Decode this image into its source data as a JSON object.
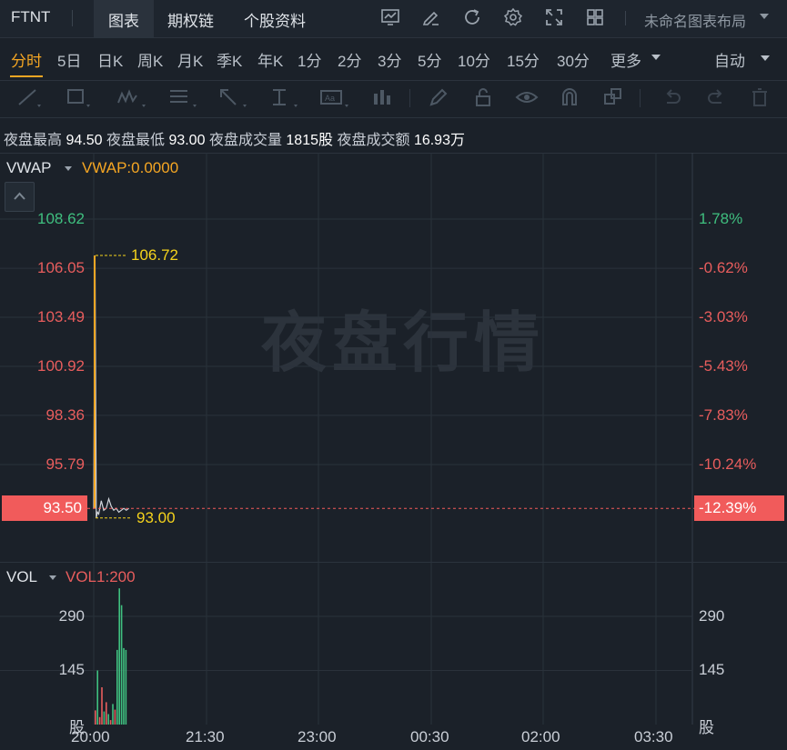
{
  "topbar": {
    "symbol": "FTNT",
    "tabs": [
      "图表",
      "期权链",
      "个股资料"
    ],
    "layout_name": "未命名图表布局"
  },
  "periods": {
    "items": [
      "分时",
      "5日",
      "日K",
      "周K",
      "月K",
      "季K",
      "年K",
      "1分",
      "2分",
      "3分",
      "5分",
      "10分",
      "15分",
      "30分",
      "更多"
    ],
    "active": "分时",
    "auto": "自动"
  },
  "info": {
    "high_label": "夜盘最高",
    "high": "94.50",
    "low_label": "夜盘最低",
    "low": "93.00",
    "vol_label": "夜盘成交量",
    "vol": "1815股",
    "amt_label": "夜盘成交额",
    "amt": "16.93万"
  },
  "main_panel": {
    "indicator": "VWAP",
    "indicator_value": "VWAP:0.0000",
    "watermark": "夜盘行情",
    "current_price": "93.50",
    "current_pct": "-12.39%",
    "max_label": "106.72",
    "min_label": "93.00"
  },
  "vol_panel": {
    "indicator": "VOL",
    "indicator_value": "VOL1:200",
    "unit": "股"
  },
  "colors": {
    "up": "#3fbf7f",
    "down": "#e85d5d",
    "accent": "#f5a623",
    "current_bg": "#f15b5b"
  },
  "chart_data": [
    {
      "type": "line",
      "title": "",
      "x_ticks": [
        "20:00",
        "21:30",
        "23:00",
        "00:30",
        "02:00",
        "03:30"
      ],
      "y_ticks_left": [
        "108.62",
        "106.05",
        "103.49",
        "100.92",
        "98.36",
        "95.79"
      ],
      "y_ticks_right": [
        "1.78%",
        "-0.62%",
        "-3.03%",
        "-5.43%",
        "-7.83%",
        "-10.24%"
      ],
      "ylim": [
        92.5,
        110.0
      ],
      "series": [
        {
          "x": [
            "20:00",
            "20:01",
            "20:02",
            "20:03",
            "20:04",
            "20:06",
            "20:08",
            "20:10",
            "20:12",
            "20:14",
            "20:16",
            "20:18",
            "20:20",
            "20:22",
            "20:24",
            "20:26",
            "20:28"
          ],
          "values": [
            93.5,
            106.72,
            93.0,
            93.3,
            93.2,
            93.9,
            93.4,
            93.5,
            94.0,
            93.6,
            93.4,
            93.5,
            93.3,
            93.4,
            93.5,
            93.4,
            93.5
          ]
        }
      ],
      "annotations": {
        "max": 106.72,
        "min": 93.0,
        "last": 93.5,
        "last_pct": -12.39
      }
    },
    {
      "type": "bar",
      "title": "",
      "y_ticks": [
        "290",
        "145"
      ],
      "ylim": [
        0,
        370
      ],
      "bars": [
        {
          "t": 0,
          "value": 38,
          "dir": "down"
        },
        {
          "t": 1,
          "value": 145,
          "dir": "up"
        },
        {
          "t": 2,
          "value": 20,
          "dir": "down"
        },
        {
          "t": 3,
          "value": 100,
          "dir": "down"
        },
        {
          "t": 4,
          "value": 35,
          "dir": "up"
        },
        {
          "t": 5,
          "value": 60,
          "dir": "down"
        },
        {
          "t": 6,
          "value": 28,
          "dir": "up"
        },
        {
          "t": 7,
          "value": 12,
          "dir": "down"
        },
        {
          "t": 8,
          "value": 55,
          "dir": "up"
        },
        {
          "t": 9,
          "value": 40,
          "dir": "down"
        },
        {
          "t": 10,
          "value": 200,
          "dir": "up"
        },
        {
          "t": 11,
          "value": 365,
          "dir": "up"
        },
        {
          "t": 12,
          "value": 320,
          "dir": "up"
        },
        {
          "t": 13,
          "value": 205,
          "dir": "up"
        },
        {
          "t": 14,
          "value": 200,
          "dir": "up"
        }
      ]
    }
  ]
}
